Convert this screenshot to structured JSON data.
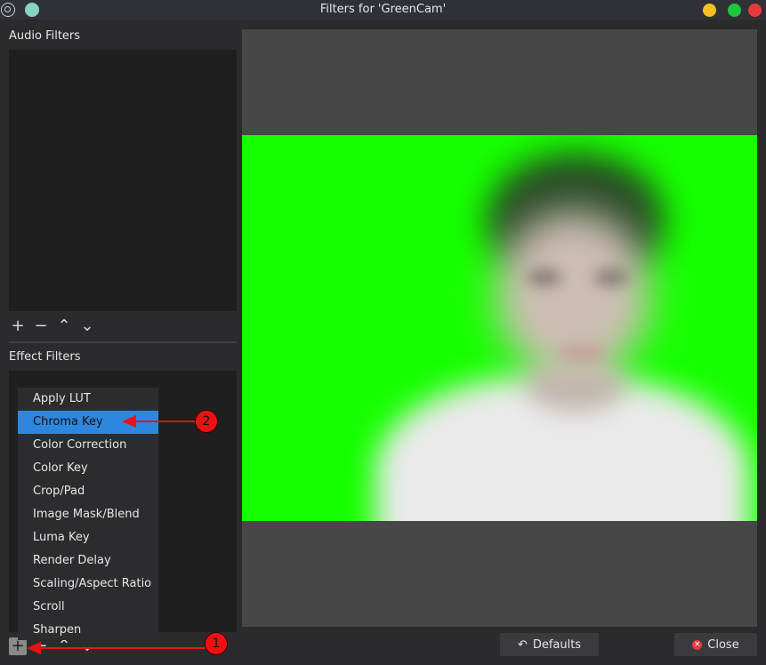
{
  "window": {
    "title": "Filters for 'GreenCam'"
  },
  "audio_filters": {
    "label": "Audio Filters",
    "toolbar": {
      "add": "+",
      "remove": "−",
      "up": "⌃",
      "down": "⌄"
    }
  },
  "effect_filters": {
    "label": "Effect Filters",
    "toolbar": {
      "add": "+",
      "remove": "−",
      "up": "⌃",
      "down": "⌄"
    }
  },
  "add_menu": {
    "items": [
      {
        "label": "Apply LUT",
        "selected": false
      },
      {
        "label": "Chroma Key",
        "selected": true
      },
      {
        "label": "Color Correction",
        "selected": false
      },
      {
        "label": "Color Key",
        "selected": false
      },
      {
        "label": "Crop/Pad",
        "selected": false
      },
      {
        "label": "Image Mask/Blend",
        "selected": false
      },
      {
        "label": "Luma Key",
        "selected": false
      },
      {
        "label": "Render Delay",
        "selected": false
      },
      {
        "label": "Scaling/Aspect Ratio",
        "selected": false
      },
      {
        "label": "Scroll",
        "selected": false
      },
      {
        "label": "Sharpen",
        "selected": false
      }
    ]
  },
  "buttons": {
    "defaults": "Defaults",
    "close": "Close"
  },
  "annotations": {
    "step1": "1",
    "step2": "2"
  },
  "colors": {
    "chroma_green": "#16ff00",
    "selection": "#2e87df",
    "annotation": "#ee1111"
  }
}
